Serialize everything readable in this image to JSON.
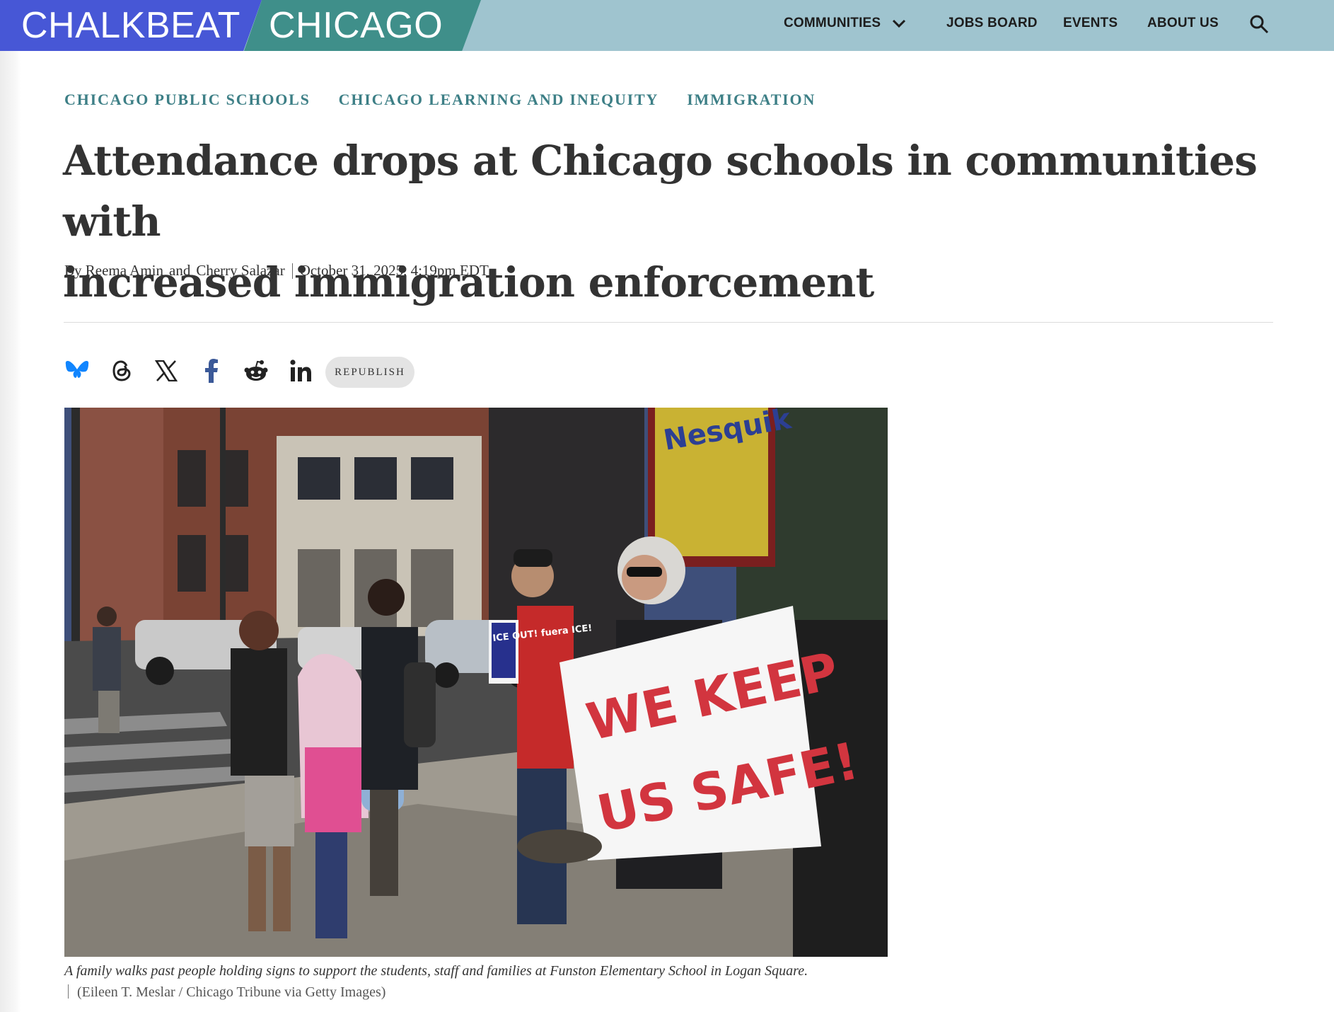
{
  "header": {
    "logo_primary": "CHALKBEAT",
    "logo_secondary": "CHICAGO",
    "nav": [
      {
        "label": "COMMUNITIES"
      },
      {
        "label": "JOBS BOARD"
      },
      {
        "label": "EVENTS"
      },
      {
        "label": "ABOUT US"
      }
    ],
    "colors": {
      "bar": "#9fc4cf",
      "logo_blue": "#4757d6",
      "logo_teal": "#3f8f8a"
    }
  },
  "article": {
    "tags": [
      "CHICAGO PUBLIC SCHOOLS",
      "CHICAGO LEARNING AND INEQUITY",
      "IMMIGRATION"
    ],
    "headline_line1": "Attendance drops at Chicago schools in communities with",
    "headline_line2": "increased immigration enforcement",
    "byline": {
      "prefix": "By",
      "author1": "Reema Amin",
      "conjunction": "and",
      "author2": "Cherry Salazar",
      "date": "October 31, 2025, 4:19pm EDT"
    },
    "share": {
      "icons": [
        "bluesky-icon",
        "threads-icon",
        "x-icon",
        "facebook-icon",
        "reddit-icon",
        "linkedin-icon"
      ],
      "republish_label": "REPUBLISH"
    },
    "photo": {
      "sign_text_1": "WE KEEP",
      "sign_text_2": "US SAFE!",
      "small_sign_text": "ICE OUT! fuera ICE!",
      "billboard_text": "Nesquik"
    },
    "caption": "A family walks past people holding signs to support the students, staff and families at Funston Elementary School in Logan Square.",
    "credit": "(Eileen T. Meslar / Chicago Tribune via Getty Images)"
  }
}
